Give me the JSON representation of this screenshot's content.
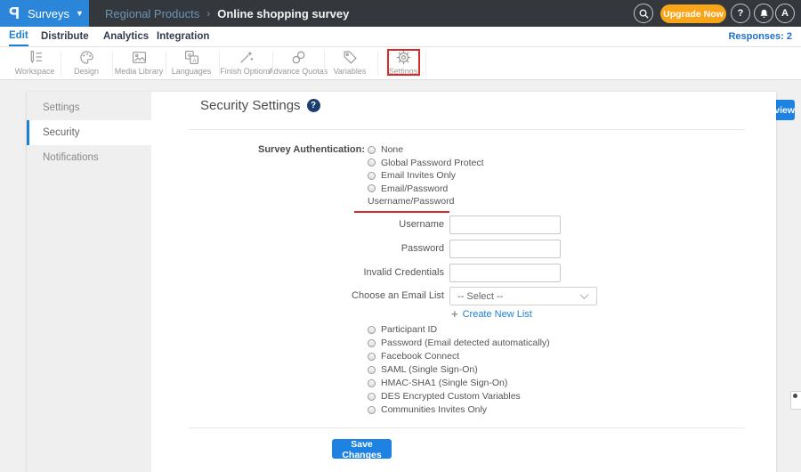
{
  "header": {
    "logo_letter": "P",
    "product_menu": "Surveys",
    "menu_caret": "▼",
    "breadcrumb_folder": "Regional Products",
    "breadcrumb_sep": "›",
    "breadcrumb_title": "Online shopping survey",
    "upgrade_label": "Upgrade Now",
    "help_label": "?",
    "avatar_letter": "A"
  },
  "nav": {
    "items": [
      {
        "label": "Edit"
      },
      {
        "label": "Distribute"
      },
      {
        "label": "Analytics"
      },
      {
        "label": "Integration"
      }
    ],
    "responses_label": "Responses: 2"
  },
  "toolbar": {
    "items": [
      {
        "label": "Workspace"
      },
      {
        "label": "Design"
      },
      {
        "label": "Media Library"
      },
      {
        "label": "Languages"
      },
      {
        "label": "Finish Options"
      },
      {
        "label": "Advance Quotas"
      },
      {
        "label": "Variables"
      },
      {
        "label": "Settings"
      }
    ],
    "url_value": "https://www.questionpro.com/t/APNrfZ",
    "preview_label": "Preview"
  },
  "sidebar": {
    "items": [
      {
        "label": "Settings"
      },
      {
        "label": "Security"
      },
      {
        "label": "Notifications"
      }
    ],
    "active": "Security"
  },
  "main": {
    "title": "Security Settings",
    "help_label": "?",
    "auth_label": "Survey Authentication:",
    "auth_top": [
      "None",
      "Global Password Protect",
      "Email Invites Only",
      "Email/Password",
      "Username/Password"
    ],
    "selected_option": "Username/Password",
    "field_username": "Username",
    "field_password": "Password",
    "field_invalid": "Invalid Credentials",
    "field_email_list": "Choose an Email List",
    "email_list_value": "-- Select --",
    "create_link": "Create New List",
    "create_plus": "+",
    "auth_bottom": [
      "Participant ID",
      "Password (Email detected automatically)",
      "Facebook Connect",
      "SAML (Single Sign-On)",
      "HMAC-SHA1 (Single Sign-On)",
      "DES Encrypted Custom Variables",
      "Communities Invites Only"
    ],
    "save_label": "Save Changes"
  },
  "colors": {
    "brand_blue": "#2b85d8",
    "link_blue": "#1d7fd1",
    "upgrade_orange": "#f9a51a",
    "annotation_red": "#d92b2b",
    "save_blue": "#1d82e2",
    "help_navy": "#1d3e70",
    "header_dark": "#34383d"
  }
}
